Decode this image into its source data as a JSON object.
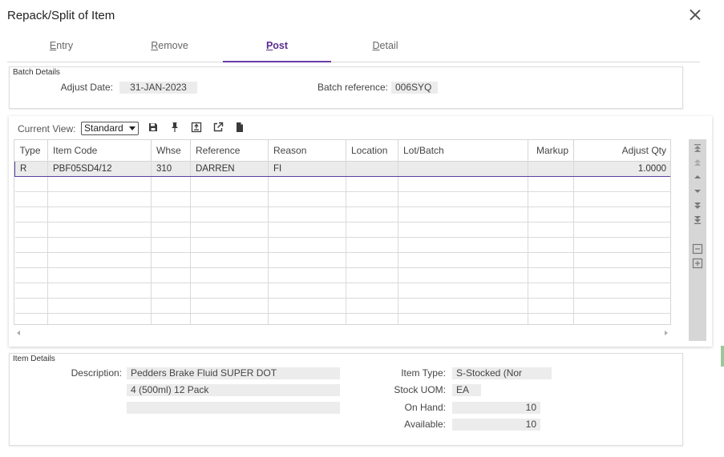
{
  "dialog": {
    "title": "Repack/Split of Item"
  },
  "tabs": [
    {
      "prefix": "",
      "underlined": "E",
      "rest": "ntry"
    },
    {
      "prefix": "",
      "underlined": "R",
      "rest": "emove"
    },
    {
      "prefix": "",
      "underlined": "P",
      "rest": "ost"
    },
    {
      "prefix": "",
      "underlined": "D",
      "rest": "etail"
    }
  ],
  "active_tab": "Post",
  "batch": {
    "legend": "Batch Details",
    "adjust_date_label": "Adjust Date:",
    "adjust_date": "31-JAN-2023",
    "reference_label": "Batch reference:",
    "reference": "006SYQ"
  },
  "grid": {
    "current_view_label": "Current View:",
    "current_view": "Standard",
    "toolbar_icons": [
      "save-icon",
      "pin-icon",
      "export-excel-icon",
      "open-external-icon",
      "document-icon"
    ],
    "columns": [
      "Type",
      "Item Code",
      "Whse",
      "Reference",
      "Reason",
      "Location",
      "Lot/Batch",
      "Markup",
      "Adjust Qty"
    ],
    "rows": [
      [
        "R",
        "PBF05SD4/12",
        "310",
        "DARREN",
        "FI",
        "",
        "",
        "",
        "1.0000"
      ]
    ],
    "empty_rows": 10,
    "side_buttons": [
      "move-top-icon",
      "move-up-page-icon",
      "move-up-icon",
      "move-down-icon",
      "move-down-page-icon",
      "move-bottom-icon",
      "collapse-icon",
      "expand-icon"
    ]
  },
  "item": {
    "legend": "Item Details",
    "description_label": "Description:",
    "description_line1": "Pedders Brake Fluid SUPER DOT",
    "description_line2": "4 (500ml) 12 Pack",
    "description_line3": "",
    "item_type_label": "Item Type:",
    "item_type": "S-Stocked (Nor",
    "stock_uom_label": "Stock UOM:",
    "stock_uom": "EA",
    "on_hand_label": "On Hand:",
    "on_hand": "10",
    "available_label": "Available:",
    "available": "10"
  },
  "colors": {
    "accent": "#5b2d91",
    "field_bg": "#ececec",
    "side_panel": "#d6d6d6"
  }
}
